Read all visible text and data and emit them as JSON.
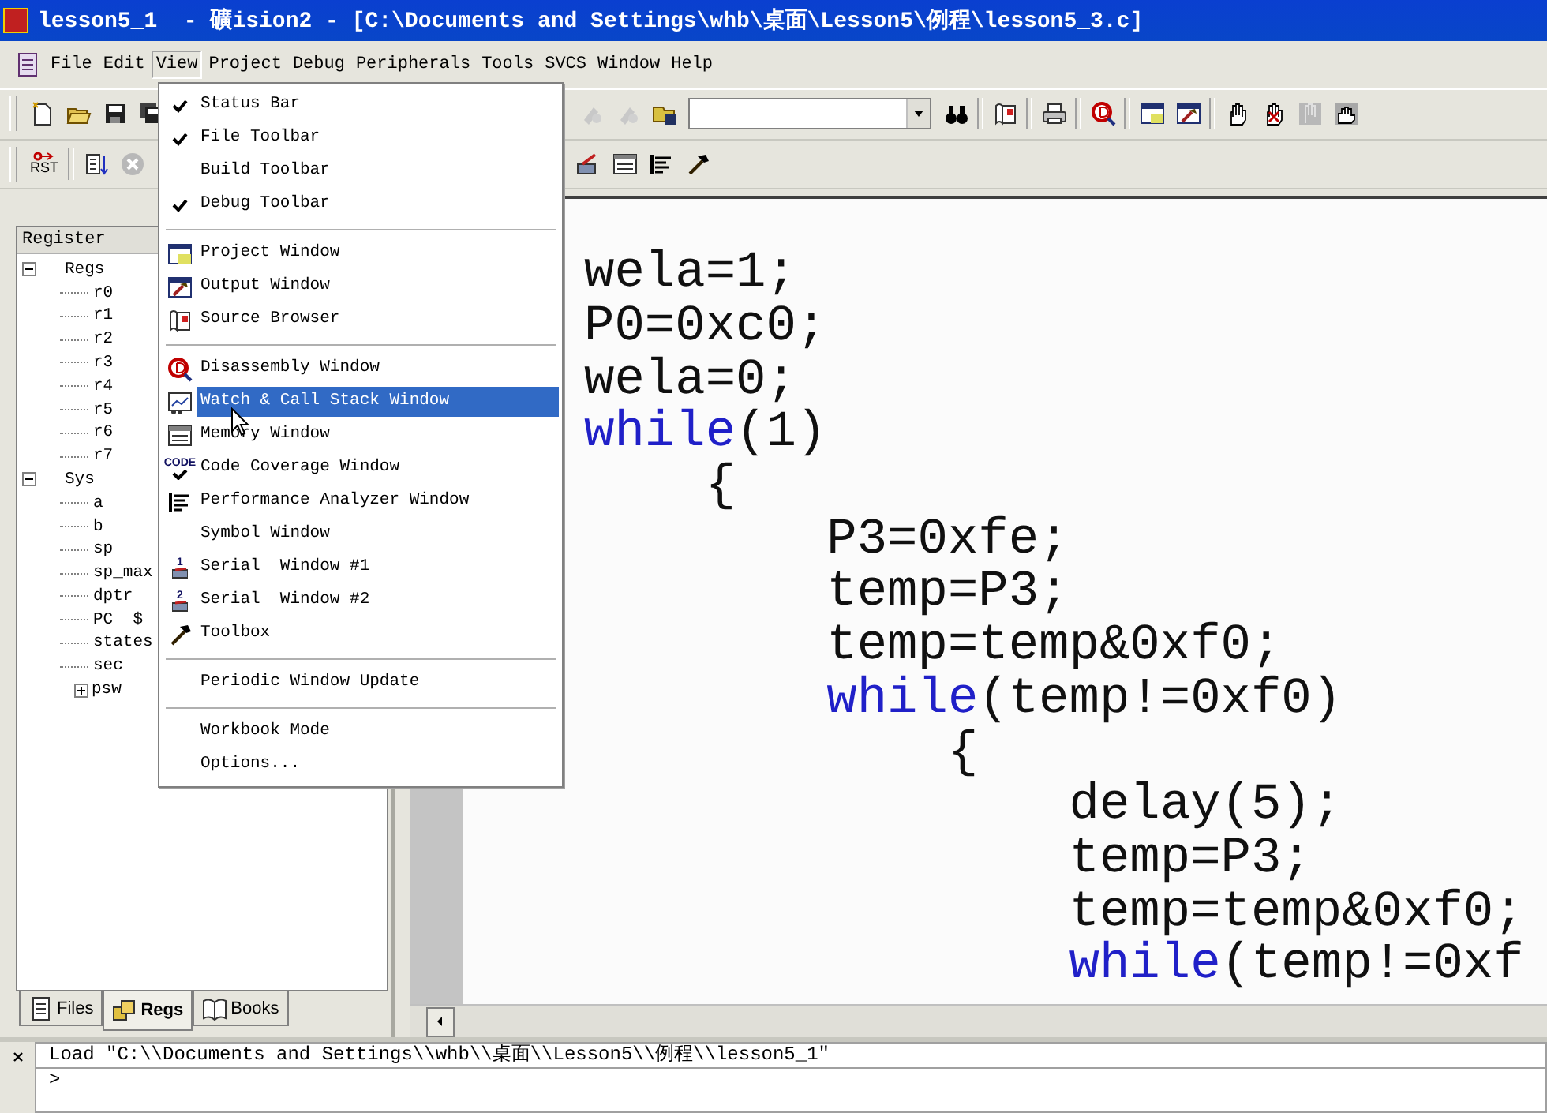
{
  "window": {
    "title": "lesson5_1  - 礦ision2 - [C:\\Documents and Settings\\whb\\桌面\\Lesson5\\例程\\lesson5_3.c]"
  },
  "menu_bar": [
    {
      "label": "File",
      "selected": false
    },
    {
      "label": "Edit",
      "selected": false
    },
    {
      "label": "View",
      "selected": true
    },
    {
      "label": "Project",
      "selected": false
    },
    {
      "label": "Debug",
      "selected": false
    },
    {
      "label": "Peripherals",
      "selected": false
    },
    {
      "label": "Tools",
      "selected": false
    },
    {
      "label": "SVCS",
      "selected": false
    },
    {
      "label": "Window",
      "selected": false
    },
    {
      "label": "Help",
      "selected": false
    }
  ],
  "debug_toolbar": {
    "reset_label": "RST"
  },
  "view_menu": {
    "items": [
      {
        "kind": "item",
        "label": "Status Bar",
        "checked": true,
        "selected": false
      },
      {
        "kind": "item",
        "label": "File Toolbar",
        "checked": true,
        "selected": false
      },
      {
        "kind": "item",
        "label": "Build Toolbar",
        "checked": false,
        "selected": false
      },
      {
        "kind": "item",
        "label": "Debug Toolbar",
        "checked": true,
        "selected": false
      },
      {
        "kind": "separator"
      },
      {
        "kind": "item",
        "label": "Project Window",
        "checked": false,
        "selected": false
      },
      {
        "kind": "item",
        "label": "Output Window",
        "checked": false,
        "selected": false
      },
      {
        "kind": "item",
        "label": "Source Browser",
        "checked": false,
        "selected": false
      },
      {
        "kind": "separator"
      },
      {
        "kind": "item",
        "label": "Disassembly Window",
        "checked": false,
        "selected": false
      },
      {
        "kind": "item",
        "label": "Watch & Call Stack Window",
        "checked": false,
        "selected": true
      },
      {
        "kind": "item",
        "label": "Memory Window",
        "checked": false,
        "selected": false
      },
      {
        "kind": "item",
        "label": "Code Coverage Window",
        "checked": false,
        "selected": false,
        "icon_text": "CODE"
      },
      {
        "kind": "item",
        "label": "Performance Analyzer Window",
        "checked": false,
        "selected": false
      },
      {
        "kind": "item",
        "label": "Symbol Window",
        "checked": false,
        "selected": false
      },
      {
        "kind": "item",
        "label": "Serial  Window #1",
        "checked": false,
        "selected": false,
        "icon_text": "1"
      },
      {
        "kind": "item",
        "label": "Serial  Window #2",
        "checked": false,
        "selected": false,
        "icon_text": "2"
      },
      {
        "kind": "item",
        "label": "Toolbox",
        "checked": false,
        "selected": false
      },
      {
        "kind": "separator"
      },
      {
        "kind": "item",
        "label": "Periodic Window Update",
        "checked": false,
        "selected": false
      },
      {
        "kind": "separator"
      },
      {
        "kind": "item",
        "label": "Workbook Mode",
        "checked": false,
        "selected": false
      },
      {
        "kind": "item",
        "label": "Options...",
        "checked": false,
        "selected": false
      }
    ]
  },
  "register_panel": {
    "title": "Register",
    "tree": [
      {
        "label": "Regs",
        "expanded": true,
        "children": [
          {
            "label": "r0"
          },
          {
            "label": "r1"
          },
          {
            "label": "r2"
          },
          {
            "label": "r3"
          },
          {
            "label": "r4"
          },
          {
            "label": "r5"
          },
          {
            "label": "r6"
          },
          {
            "label": "r7"
          }
        ]
      },
      {
        "label": "Sys",
        "expanded": true,
        "children": [
          {
            "label": "a"
          },
          {
            "label": "b"
          },
          {
            "label": "sp"
          },
          {
            "label": "sp_max"
          },
          {
            "label": "dptr"
          },
          {
            "label": "PC  $"
          },
          {
            "label": "states"
          },
          {
            "label": "sec"
          },
          {
            "label": "psw",
            "expanded": false
          }
        ]
      }
    ]
  },
  "panel_tabs": [
    {
      "label": "Files",
      "selected": false
    },
    {
      "label": "Regs",
      "selected": true
    },
    {
      "label": "Books",
      "selected": false
    }
  ],
  "editor": {
    "lines": [
      [
        {
          "kind": "plain",
          "text": "wela=1;"
        }
      ],
      [
        {
          "kind": "plain",
          "text": "P0=0xc0;"
        }
      ],
      [
        {
          "kind": "plain",
          "text": "wela=0;"
        }
      ],
      [
        {
          "kind": "keyword",
          "text": "while"
        },
        {
          "kind": "plain",
          "text": "(1)"
        }
      ],
      [
        {
          "kind": "plain",
          "text": "    {"
        }
      ],
      [
        {
          "kind": "plain",
          "text": "        P3=0xfe;"
        }
      ],
      [
        {
          "kind": "plain",
          "text": "        temp=P3;"
        }
      ],
      [
        {
          "kind": "plain",
          "text": "        temp=temp&0xf0;"
        }
      ],
      [
        {
          "kind": "keyword",
          "text": "        while"
        },
        {
          "kind": "plain",
          "text": "(temp!=0xf0)"
        }
      ],
      [
        {
          "kind": "plain",
          "text": "            {"
        }
      ],
      [
        {
          "kind": "plain",
          "text": "                delay(5);"
        }
      ],
      [
        {
          "kind": "plain",
          "text": "                temp=P3;"
        }
      ],
      [
        {
          "kind": "plain",
          "text": "                temp=temp&0xf0;"
        }
      ],
      [
        {
          "kind": "keyword",
          "text": "                while"
        },
        {
          "kind": "plain",
          "text": "(temp!=0xf"
        }
      ]
    ]
  },
  "output": {
    "lines": [
      "Load \"C:\\\\Documents and Settings\\\\whb\\\\桌面\\\\Lesson5\\\\例程\\\\lesson5_1\"",
      ">"
    ]
  }
}
